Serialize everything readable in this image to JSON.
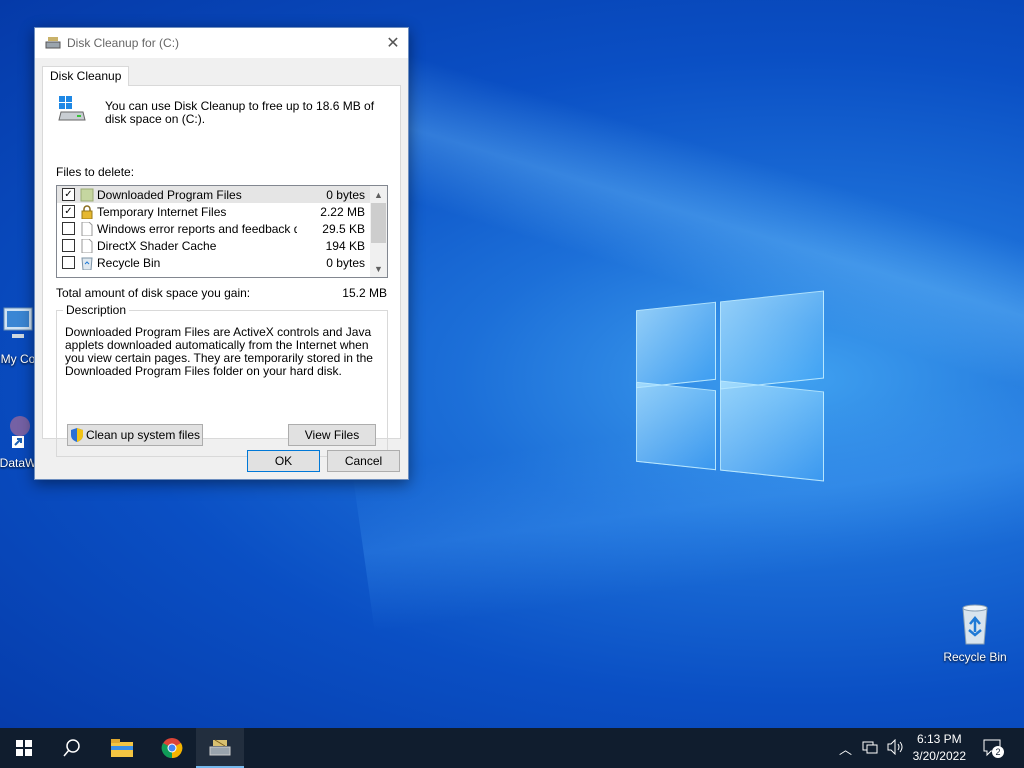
{
  "dialog": {
    "title": "Disk Cleanup for  (C:)",
    "tab_label": "Disk Cleanup",
    "intro_text": "You can use Disk Cleanup to free up to 18.6 MB of disk space on  (C:).",
    "files_to_delete_label": "Files to delete:",
    "files": [
      {
        "name": "Downloaded Program Files",
        "size": "0 bytes",
        "checked": true,
        "icon": "folder-icon"
      },
      {
        "name": "Temporary Internet Files",
        "size": "2.22 MB",
        "checked": true,
        "icon": "lock-icon"
      },
      {
        "name": "Windows error reports and feedback di...",
        "size": "29.5 KB",
        "checked": false,
        "icon": "file-icon"
      },
      {
        "name": "DirectX Shader Cache",
        "size": "194 KB",
        "checked": false,
        "icon": "file-icon"
      },
      {
        "name": "Recycle Bin",
        "size": "0 bytes",
        "checked": false,
        "icon": "recycle-bin-icon"
      }
    ],
    "total_label": "Total amount of disk space you gain:",
    "total_value": "15.2 MB",
    "description_label": "Description",
    "description_text": "Downloaded Program Files are ActiveX controls and Java applets downloaded automatically from the Internet when you view certain pages. They are temporarily stored in the Downloaded Program Files folder on your hard disk.",
    "clean_system_button": "Clean up system files",
    "view_files_button": "View Files",
    "ok_button": "OK",
    "cancel_button": "Cancel"
  },
  "desktop": {
    "icons": [
      {
        "label": "My Co",
        "icon": "computer-icon"
      },
      {
        "label": "DataW",
        "icon": "shortcut-icon"
      },
      {
        "label": "Recycle Bin",
        "icon": "recycle-bin-icon"
      }
    ]
  },
  "taskbar": {
    "items": [
      "start-icon",
      "search-icon",
      "file-explorer-icon",
      "chrome-icon",
      "disk-cleanup-icon"
    ],
    "time": "6:13 PM",
    "date": "3/20/2022",
    "notification_count": "2"
  },
  "colors": {
    "accent": "#0078d7",
    "taskbar": "#101d2e",
    "desktop": "#0a4fc4"
  }
}
